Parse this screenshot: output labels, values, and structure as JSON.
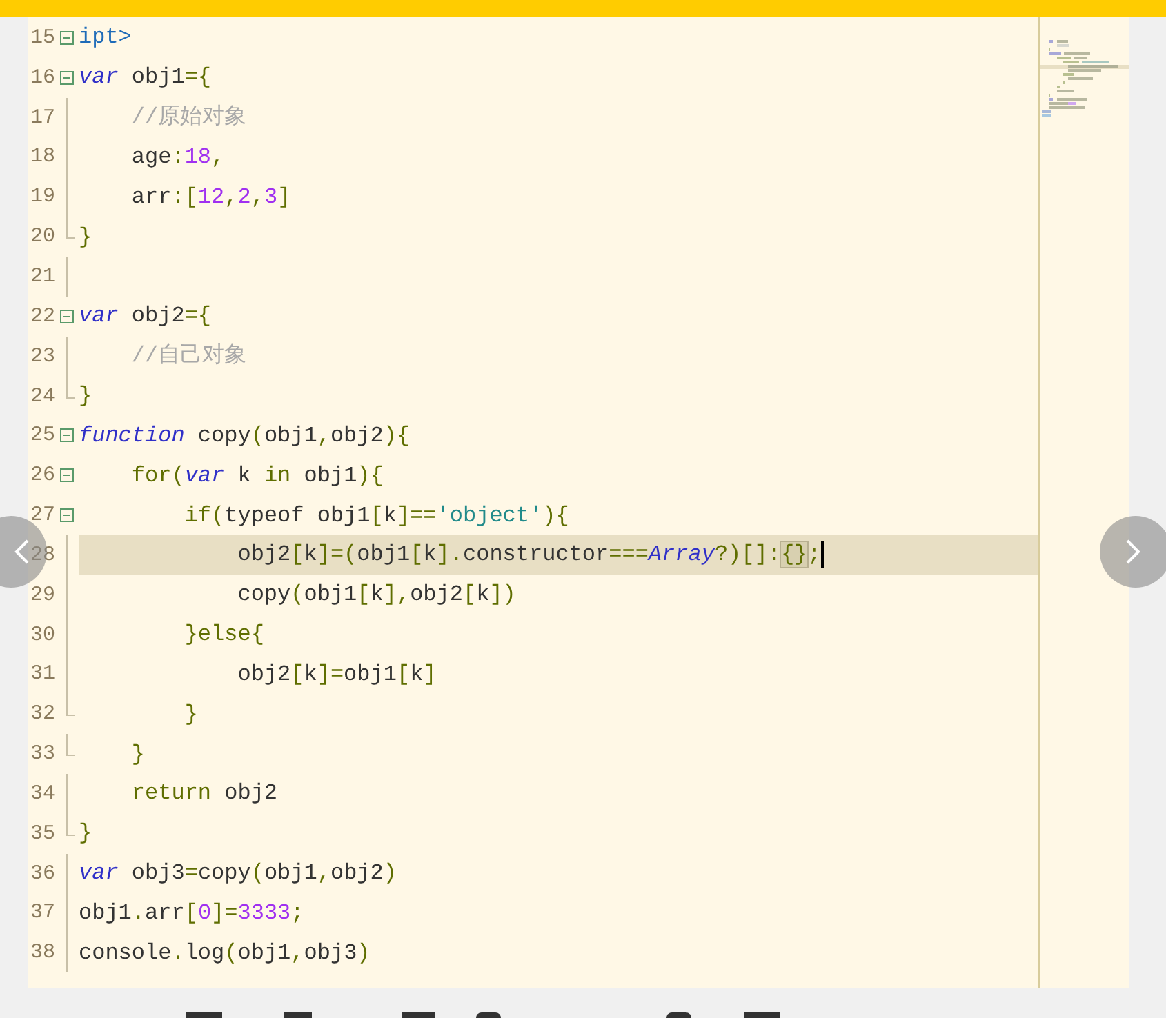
{
  "editor": {
    "lines": [
      {
        "number": "15",
        "fold_start": true,
        "fold_end": false,
        "current": false,
        "tokens": [
          {
            "kind": "tag",
            "text": "ipt>"
          }
        ]
      },
      {
        "number": "16",
        "fold_start": true,
        "fold_end": false,
        "current": false,
        "tokens": [
          {
            "kind": "keyword",
            "text": "var"
          },
          {
            "kind": "ident",
            "text": " obj1"
          },
          {
            "kind": "punct",
            "text": "={"
          }
        ]
      },
      {
        "number": "17",
        "fold_start": false,
        "fold_end": false,
        "current": false,
        "tokens": [
          {
            "kind": "comment",
            "text": "    //原始对象"
          }
        ]
      },
      {
        "number": "18",
        "fold_start": false,
        "fold_end": false,
        "current": false,
        "tokens": [
          {
            "kind": "ident",
            "text": "    age"
          },
          {
            "kind": "punct",
            "text": ":"
          },
          {
            "kind": "number",
            "text": "18"
          },
          {
            "kind": "punct",
            "text": ","
          }
        ]
      },
      {
        "number": "19",
        "fold_start": false,
        "fold_end": false,
        "current": false,
        "tokens": [
          {
            "kind": "ident",
            "text": "    arr"
          },
          {
            "kind": "punct",
            "text": ":["
          },
          {
            "kind": "number",
            "text": "12"
          },
          {
            "kind": "punct",
            "text": ","
          },
          {
            "kind": "number",
            "text": "2"
          },
          {
            "kind": "punct",
            "text": ","
          },
          {
            "kind": "number",
            "text": "3"
          },
          {
            "kind": "punct",
            "text": "]"
          }
        ]
      },
      {
        "number": "20",
        "fold_start": false,
        "fold_end": true,
        "current": false,
        "tokens": [
          {
            "kind": "punct",
            "text": "}"
          }
        ]
      },
      {
        "number": "21",
        "fold_start": false,
        "fold_end": false,
        "current": false
      },
      {
        "number": "22",
        "fold_start": true,
        "fold_end": false,
        "current": false,
        "tokens": [
          {
            "kind": "keyword",
            "text": "var"
          },
          {
            "kind": "ident",
            "text": " obj2"
          },
          {
            "kind": "punct",
            "text": "={"
          }
        ]
      },
      {
        "number": "23",
        "fold_start": false,
        "fold_end": false,
        "current": false,
        "tokens": [
          {
            "kind": "comment",
            "text": "    //自己对象"
          }
        ]
      },
      {
        "number": "24",
        "fold_start": false,
        "fold_end": true,
        "current": false,
        "tokens": [
          {
            "kind": "punct",
            "text": "}"
          }
        ]
      },
      {
        "number": "25",
        "fold_start": true,
        "fold_end": false,
        "current": false,
        "tokens": [
          {
            "kind": "keyword",
            "text": "function"
          },
          {
            "kind": "ident",
            "text": " copy"
          },
          {
            "kind": "punct",
            "text": "("
          },
          {
            "kind": "ident",
            "text": "obj1"
          },
          {
            "kind": "punct",
            "text": ","
          },
          {
            "kind": "ident",
            "text": "obj2"
          },
          {
            "kind": "punct",
            "text": "){"
          }
        ]
      },
      {
        "number": "26",
        "fold_start": true,
        "fold_end": false,
        "current": false,
        "tokens": [
          {
            "kind": "control",
            "text": "    for"
          },
          {
            "kind": "punct",
            "text": "("
          },
          {
            "kind": "keyword",
            "text": "var"
          },
          {
            "kind": "ident",
            "text": " k "
          },
          {
            "kind": "control",
            "text": "in"
          },
          {
            "kind": "ident",
            "text": " obj1"
          },
          {
            "kind": "punct",
            "text": "){"
          }
        ]
      },
      {
        "number": "27",
        "fold_start": true,
        "fold_end": false,
        "current": false,
        "tokens": [
          {
            "kind": "control",
            "text": "        if"
          },
          {
            "kind": "punct",
            "text": "("
          },
          {
            "kind": "ident",
            "text": "typeof obj1"
          },
          {
            "kind": "punct",
            "text": "["
          },
          {
            "kind": "ident",
            "text": "k"
          },
          {
            "kind": "punct",
            "text": "]=="
          },
          {
            "kind": "string",
            "text": "'object'"
          },
          {
            "kind": "punct",
            "text": "){"
          }
        ]
      },
      {
        "number": "28",
        "fold_start": false,
        "fold_end": false,
        "current": true,
        "tokens": [
          {
            "kind": "ident",
            "text": "            obj2"
          },
          {
            "kind": "punct",
            "text": "["
          },
          {
            "kind": "ident",
            "text": "k"
          },
          {
            "kind": "punct",
            "text": "]=("
          },
          {
            "kind": "ident",
            "text": "obj1"
          },
          {
            "kind": "punct",
            "text": "["
          },
          {
            "kind": "ident",
            "text": "k"
          },
          {
            "kind": "punct",
            "text": "]."
          },
          {
            "kind": "ident",
            "text": "constructor"
          },
          {
            "kind": "punct",
            "text": "==="
          },
          {
            "kind": "keyword",
            "text": "Array"
          },
          {
            "kind": "punct",
            "text": "?)[]:"
          },
          {
            "kind": "match",
            "text": "{}"
          },
          {
            "kind": "punct",
            "text": ";"
          }
        ]
      },
      {
        "number": "29",
        "fold_start": false,
        "fold_end": false,
        "current": false,
        "tokens": [
          {
            "kind": "ident",
            "text": "            copy"
          },
          {
            "kind": "punct",
            "text": "("
          },
          {
            "kind": "ident",
            "text": "obj1"
          },
          {
            "kind": "punct",
            "text": "["
          },
          {
            "kind": "ident",
            "text": "k"
          },
          {
            "kind": "punct",
            "text": "],"
          },
          {
            "kind": "ident",
            "text": "obj2"
          },
          {
            "kind": "punct",
            "text": "["
          },
          {
            "kind": "ident",
            "text": "k"
          },
          {
            "kind": "punct",
            "text": "])"
          }
        ]
      },
      {
        "number": "30",
        "fold_start": false,
        "fold_end": false,
        "current": false,
        "tokens": [
          {
            "kind": "punct",
            "text": "        }"
          },
          {
            "kind": "control",
            "text": "else"
          },
          {
            "kind": "punct",
            "text": "{"
          }
        ]
      },
      {
        "number": "31",
        "fold_start": false,
        "fold_end": false,
        "current": false,
        "tokens": [
          {
            "kind": "ident",
            "text": "            obj2"
          },
          {
            "kind": "punct",
            "text": "["
          },
          {
            "kind": "ident",
            "text": "k"
          },
          {
            "kind": "punct",
            "text": "]="
          },
          {
            "kind": "ident",
            "text": "obj1"
          },
          {
            "kind": "punct",
            "text": "["
          },
          {
            "kind": "ident",
            "text": "k"
          },
          {
            "kind": "punct",
            "text": "]"
          }
        ]
      },
      {
        "number": "32",
        "fold_start": false,
        "fold_end": true,
        "current": false,
        "tokens": [
          {
            "kind": "punct",
            "text": "        }"
          }
        ]
      },
      {
        "number": "33",
        "fold_start": false,
        "fold_end": true,
        "current": false,
        "tokens": [
          {
            "kind": "punct",
            "text": "    }"
          }
        ]
      },
      {
        "number": "34",
        "fold_start": false,
        "fold_end": false,
        "current": false,
        "tokens": [
          {
            "kind": "control",
            "text": "    return"
          },
          {
            "kind": "ident",
            "text": " obj2"
          }
        ]
      },
      {
        "number": "35",
        "fold_start": false,
        "fold_end": true,
        "current": false,
        "tokens": [
          {
            "kind": "punct",
            "text": "}"
          }
        ]
      },
      {
        "number": "36",
        "fold_start": false,
        "fold_end": false,
        "current": false,
        "tokens": [
          {
            "kind": "keyword",
            "text": "var"
          },
          {
            "kind": "ident",
            "text": " obj3"
          },
          {
            "kind": "punct",
            "text": "="
          },
          {
            "kind": "ident",
            "text": "copy"
          },
          {
            "kind": "punct",
            "text": "("
          },
          {
            "kind": "ident",
            "text": "obj1"
          },
          {
            "kind": "punct",
            "text": ","
          },
          {
            "kind": "ident",
            "text": "obj2"
          },
          {
            "kind": "punct",
            "text": ")"
          }
        ]
      },
      {
        "number": "37",
        "fold_start": false,
        "fold_end": false,
        "current": false,
        "tokens": [
          {
            "kind": "ident",
            "text": "obj1"
          },
          {
            "kind": "punct",
            "text": "."
          },
          {
            "kind": "ident",
            "text": "arr"
          },
          {
            "kind": "punct",
            "text": "["
          },
          {
            "kind": "number",
            "text": "0"
          },
          {
            "kind": "punct",
            "text": "]="
          },
          {
            "kind": "number",
            "text": "3333"
          },
          {
            "kind": "punct",
            "text": ";"
          }
        ]
      },
      {
        "number": "38",
        "fold_start": false,
        "fold_end": false,
        "current": false,
        "tokens": [
          {
            "kind": "ident",
            "text": "console"
          },
          {
            "kind": "punct",
            "text": "."
          },
          {
            "kind": "ident",
            "text": "log"
          },
          {
            "kind": "punct",
            "text": "("
          },
          {
            "kind": "ident",
            "text": "obj1"
          },
          {
            "kind": "punct",
            "text": ","
          },
          {
            "kind": "ident",
            "text": "obj3"
          },
          {
            "kind": "punct",
            "text": ")"
          }
        ]
      }
    ]
  }
}
